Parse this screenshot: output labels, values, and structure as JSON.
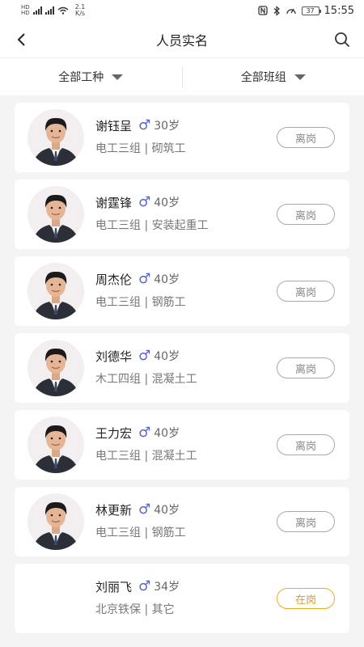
{
  "status_bar": {
    "net_labels": [
      "HD",
      "HD"
    ],
    "speed": [
      "2.1",
      "K/s"
    ],
    "battery": "37",
    "time": "15:55"
  },
  "nav": {
    "title": "人员实名"
  },
  "filters": {
    "work_type": "全部工种",
    "team": "全部班组"
  },
  "gender_symbol": "♂",
  "workers": [
    {
      "name": "谢钰呈",
      "age": "30岁",
      "team": "电工三组",
      "work_type": "砌筑工",
      "status": "离岗",
      "on_duty": false,
      "has_photo": true
    },
    {
      "name": "谢霆锋",
      "age": "40岁",
      "team": "电工三组",
      "work_type": "安装起重工",
      "status": "离岗",
      "on_duty": false,
      "has_photo": true
    },
    {
      "name": "周杰伦",
      "age": "40岁",
      "team": "电工三组",
      "work_type": "钢筋工",
      "status": "离岗",
      "on_duty": false,
      "has_photo": true
    },
    {
      "name": "刘德华",
      "age": "40岁",
      "team": "木工四组",
      "work_type": "混凝土工",
      "status": "离岗",
      "on_duty": false,
      "has_photo": true
    },
    {
      "name": "王力宏",
      "age": "40岁",
      "team": "电工三组",
      "work_type": "混凝土工",
      "status": "离岗",
      "on_duty": false,
      "has_photo": true
    },
    {
      "name": "林更新",
      "age": "40岁",
      "team": "电工三组",
      "work_type": "钢筋工",
      "status": "离岗",
      "on_duty": false,
      "has_photo": true
    },
    {
      "name": "刘丽飞",
      "age": "34岁",
      "team": "北京铁保",
      "work_type": "其它",
      "status": "在岗",
      "on_duty": true,
      "has_photo": false
    }
  ]
}
